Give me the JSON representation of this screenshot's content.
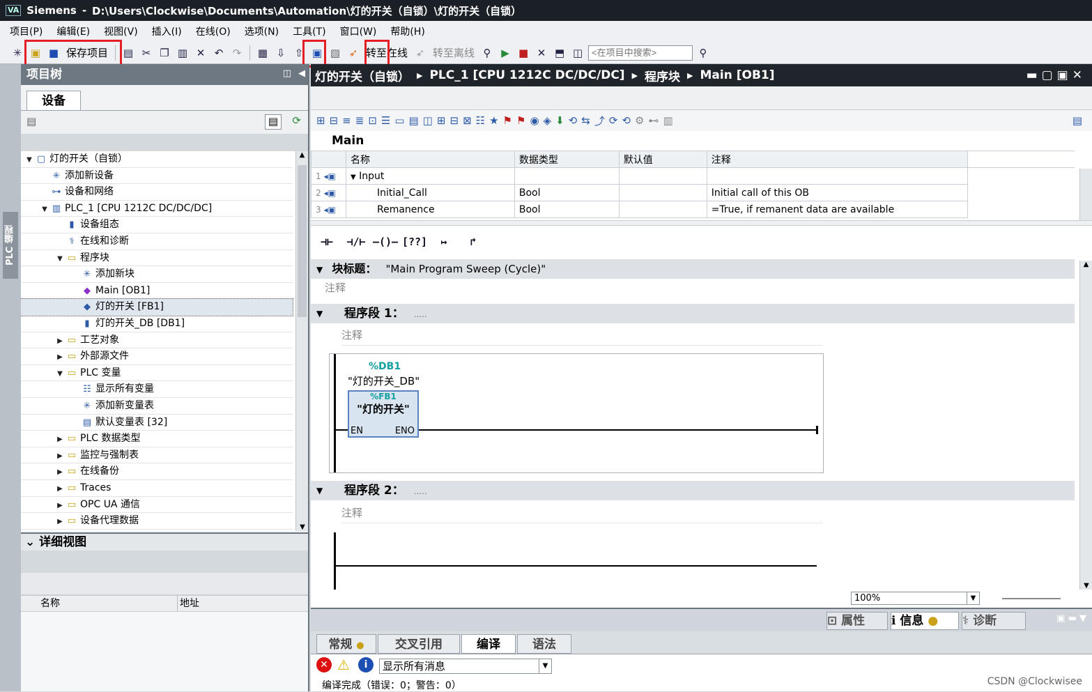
{
  "window": {
    "app": "Siemens",
    "path": "D:\\Users\\Clockwise\\Documents\\Automation\\灯的开关（自锁）\\灯的开关（自锁）"
  },
  "menu": [
    "项目(P)",
    "编辑(E)",
    "视图(V)",
    "插入(I)",
    "在线(O)",
    "选项(N)",
    "工具(T)",
    "窗口(W)",
    "帮助(H)"
  ],
  "toolbar": {
    "save_label": "保存项目",
    "go_online": "转至在线",
    "go_offline": "转至离线",
    "search_placeholder": "<在项目中搜索>"
  },
  "side_tab": "PLC 编程",
  "project_tree": {
    "title": "项目树",
    "tab": "设备",
    "items": [
      {
        "label": "灯的开关（自锁）",
        "icon": "project-icon",
        "level": 0,
        "expanded": true
      },
      {
        "label": "添加新设备",
        "icon": "add-device-icon",
        "level": 1
      },
      {
        "label": "设备和网络",
        "icon": "network-icon",
        "level": 1
      },
      {
        "label": "PLC_1 [CPU 1212C DC/DC/DC]",
        "icon": "plc-icon",
        "level": 1,
        "expanded": true
      },
      {
        "label": "设备组态",
        "icon": "device-config-icon",
        "level": 2
      },
      {
        "label": "在线和诊断",
        "icon": "diagnostics-icon",
        "level": 2
      },
      {
        "label": "程序块",
        "icon": "folder-icon",
        "level": 2,
        "expanded": true
      },
      {
        "label": "添加新块",
        "icon": "add-block-icon",
        "level": 3
      },
      {
        "label": "Main [OB1]",
        "icon": "ob-icon",
        "level": 3
      },
      {
        "label": "灯的开关 [FB1]",
        "icon": "fb-icon",
        "level": 3,
        "selected": true
      },
      {
        "label": "灯的开关_DB [DB1]",
        "icon": "db-icon",
        "level": 3
      },
      {
        "label": "工艺对象",
        "icon": "folder-icon",
        "level": 2,
        "collapsed": true
      },
      {
        "label": "外部源文件",
        "icon": "folder-icon",
        "level": 2,
        "collapsed": true
      },
      {
        "label": "PLC 变量",
        "icon": "folder-icon",
        "level": 2,
        "expanded": true
      },
      {
        "label": "显示所有变量",
        "icon": "tags-icon",
        "level": 3
      },
      {
        "label": "添加新变量表",
        "icon": "add-table-icon",
        "level": 3
      },
      {
        "label": "默认变量表 [32]",
        "icon": "table-icon",
        "level": 3
      },
      {
        "label": "PLC 数据类型",
        "icon": "folder-icon",
        "level": 2,
        "collapsed": true
      },
      {
        "label": "监控与强制表",
        "icon": "folder-icon",
        "level": 2,
        "collapsed": true
      },
      {
        "label": "在线备份",
        "icon": "folder-icon",
        "level": 2,
        "collapsed": true
      },
      {
        "label": "Traces",
        "icon": "folder-icon",
        "level": 2,
        "collapsed": true
      },
      {
        "label": "OPC UA 通信",
        "icon": "folder-icon",
        "level": 2,
        "collapsed": true
      },
      {
        "label": "设备代理数据",
        "icon": "folder-icon",
        "level": 2,
        "collapsed": true
      }
    ]
  },
  "detail_view": {
    "title": "详细视图",
    "col_name": "名称",
    "col_addr": "地址"
  },
  "breadcrumb": [
    "灯的开关（自锁）",
    "PLC_1 [CPU 1212C DC/DC/DC]",
    "程序块",
    "Main [OB1]"
  ],
  "block_name": "Main",
  "interface": {
    "headers": [
      "名称",
      "数据类型",
      "默认值",
      "注释"
    ],
    "rows": [
      {
        "no": "1",
        "name": "Input",
        "type": "",
        "default": "",
        "comment": ""
      },
      {
        "no": "2",
        "name": "Initial_Call",
        "type": "Bool",
        "default": "",
        "comment": "Initial call of this OB"
      },
      {
        "no": "3",
        "name": "Remanence",
        "type": "Bool",
        "default": "",
        "comment": "=True, if remanent data are available"
      }
    ]
  },
  "ladder_tools": [
    "⊣⊢",
    "⊣/⊢",
    "–()–",
    "[??]",
    "↦",
    "↱"
  ],
  "block_title": {
    "label": "块标题：",
    "value": "\"Main Program Sweep (Cycle)\"",
    "comment": "注释"
  },
  "networks": [
    {
      "label": "程序段 1：",
      "dots": ".....",
      "comment": "注释",
      "db_addr": "%DB1",
      "db_name": "\"灯的开关_DB\"",
      "fb_addr": "%FB1",
      "fb_name": "\"灯的开关\"",
      "en": "EN",
      "eno": "ENO"
    },
    {
      "label": "程序段 2：",
      "dots": ".....",
      "comment": "注释"
    }
  ],
  "zoom": "100%",
  "inspector": {
    "props": "属性",
    "info": "信息",
    "diag": "诊断"
  },
  "bottom_tabs": [
    "常规",
    "交叉引用",
    "编译",
    "语法"
  ],
  "filter": "显示所有消息",
  "compile_msg": "编译完成（错误：0；警告：0）",
  "watermark": "CSDN @Clockwisee"
}
